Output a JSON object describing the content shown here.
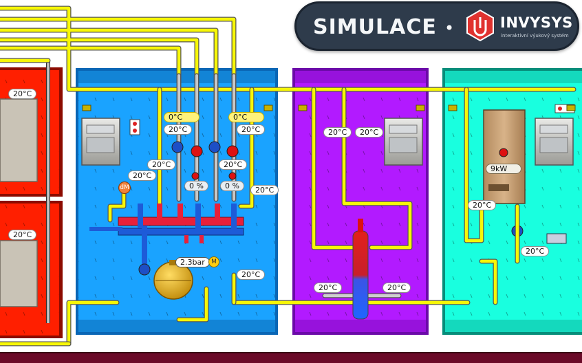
{
  "banner": {
    "title": "SIMULACE",
    "separator": "•",
    "brand": "INVYSYS",
    "tagline": "interaktivní výukový systém",
    "logo_color": "#e0322f"
  },
  "rooms": {
    "left_upper_temp": "20°C",
    "left_lower_temp": "20°C"
  },
  "boiler_room": {
    "set_temp_left": "0°C",
    "set_temp_right": "0°C",
    "sensor_left_1": "20°C",
    "sensor_right_1": "20°C",
    "sensor_left_2": "20°C",
    "sensor_right_2": "20°C",
    "sensor_left_3": "20°C",
    "valve_left_pct": "0 %",
    "valve_right_pct": "0 %",
    "sensor_return": "20°C",
    "sensor_bottom": "20°C",
    "pressure": "2.3bar",
    "dm_label": "dM"
  },
  "tank_room": {
    "sensor_top_left": "20°C",
    "sensor_top_right": "20°C",
    "sensor_bottom_left": "20°C",
    "sensor_bottom_right": "20°C"
  },
  "heater_room": {
    "power": "9kW",
    "sensor_left": "20°C",
    "sensor_right": "20°C"
  },
  "colors": {
    "red_room": "#ff1f00",
    "boiler_room": "#1aa3ff",
    "tank_room": "#b21aff",
    "heater_room": "#19ffdf",
    "pipe": "#f7f707",
    "hot_manifold": "#e8203a",
    "cold_manifold": "#1d5bd8",
    "footer": "#6b0a28"
  }
}
